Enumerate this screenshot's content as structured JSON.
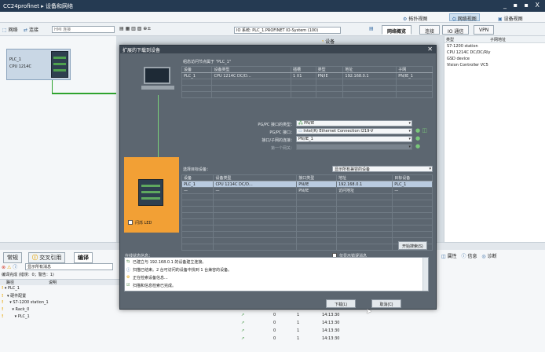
{
  "window": {
    "title": "CC24profinet ▸ 设备和网络",
    "controls": "_ ▪ ▪ X"
  },
  "viewbar": {
    "topology": "拓扑视图",
    "network": "网络视图",
    "device": "设备视图"
  },
  "toolbar": {
    "network_btn": "网络",
    "connect_btn": "连接",
    "hmi_placeholder": "HMI 连接",
    "io_system": "IO 系统: PLC_1.PROFINET IO-System (100)",
    "tabs": [
      "网络概览",
      "连接",
      "IO 通信",
      "VPN"
    ]
  },
  "canvas": {
    "device_name": "PLC_1",
    "device_type": "CPU 1214C"
  },
  "catalog": {
    "columns": [
      "类型",
      "子网地址"
    ],
    "search_label": "设备",
    "rows": [
      "S7-1200 station",
      "CPU 1214C DC/DC/Rly",
      "GSD device",
      "Vision Controller VC5"
    ]
  },
  "dialog": {
    "title": "扩展的下载到设备",
    "config_label": "组态访问节点属于 \"PLC_1\"",
    "config_table": {
      "headers": [
        "设备",
        "设备类型",
        "插槽",
        "类型",
        "地址",
        "子网"
      ],
      "rows": [
        [
          "PLC_1",
          "CPU 1214C DC/D...",
          "1 X1",
          "PN/IE",
          "192.168.0.1",
          "PN/IE_1"
        ]
      ]
    },
    "pgpc_type_label": "PG/PC 接口的类型：",
    "pgpc_type_value": "PN/IE",
    "pgpc_if_label": "PG/PC 接口：",
    "pgpc_if_value": "Intel(R) Ethernet Connection I219-V",
    "subnet_conn_label": "接口/子网的连接：",
    "subnet_conn_value": "PN/IE_1",
    "gateway_label": "第一个网关：",
    "target_label": "选择目标设备：",
    "target_filter": "显示所有兼容的设备",
    "target_table": {
      "headers": [
        "设备",
        "设备类型",
        "接口类型",
        "地址",
        "目标设备"
      ],
      "rows": [
        [
          "PLC_1",
          "CPU 1214C DC/D...",
          "PN/IE",
          "192.168.0.1",
          "PLC_1"
        ],
        [
          "—",
          "—",
          "PN/IE",
          "访问地址",
          "—"
        ]
      ]
    },
    "flash_led": "闪烁 LED",
    "start_search": "开始搜索(S)",
    "online_status_label": "在线状态信息：",
    "only_error": "仅显示错误消息",
    "log": [
      "已建立与 192.168.0.1 的设备建立连接。",
      "扫描已结束。2 台可访问的设备中找到 1 台兼容的设备。",
      "正在检索设备信息...",
      "扫描和信息检索已完成。"
    ],
    "load_btn": "下载(L)",
    "cancel_btn": "取消(C)"
  },
  "inspector": {
    "tabs": [
      "常规",
      "交叉引用",
      "编译"
    ],
    "show_all": "显示所有消息",
    "compile_status": "编译完成 (错误：0；警告：1)",
    "col_path": "路径",
    "col_desc": "说明",
    "tree": [
      "PLC_1",
      "硬件配置",
      "S7-1200 station_1",
      "Rack_0",
      "PLC_1"
    ]
  },
  "bottom_rows": [
    [
      "0",
      "1",
      "14:13:30"
    ],
    [
      "0",
      "1",
      "14:13:30"
    ],
    [
      "0",
      "1",
      "14:13:30"
    ],
    [
      "0",
      "1",
      "14:13:30"
    ]
  ],
  "info_tabs": {
    "properties": "属性",
    "info": "信息",
    "diagnostics": "诊断"
  }
}
